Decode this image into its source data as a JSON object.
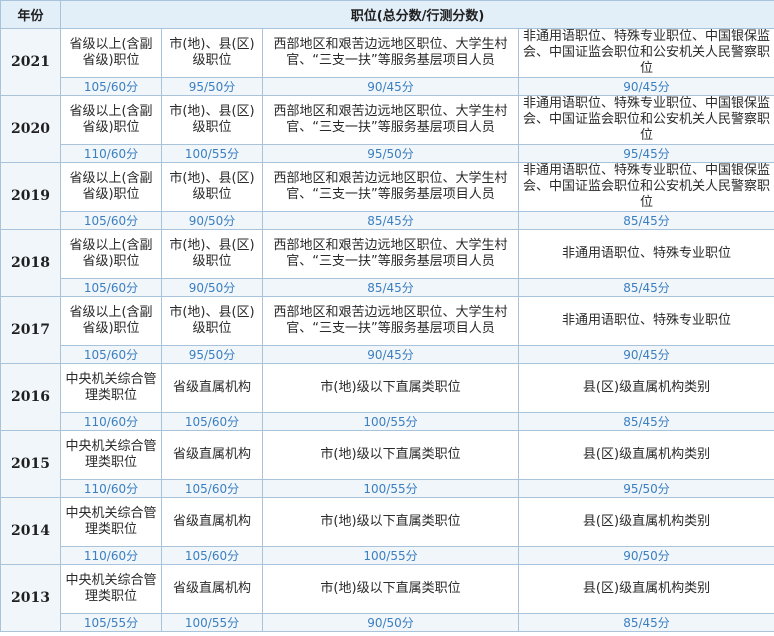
{
  "header": {
    "year_label": "年份",
    "position_label": "职位(总分数/行测分数)"
  },
  "rows": [
    {
      "year": "2021",
      "cells": [
        {
          "position": "省级以上(含副省级)职位",
          "score": "105/60分"
        },
        {
          "position": "市(地)、县(区)级职位",
          "score": "95/50分"
        },
        {
          "position": "西部地区和艰苦边远地区职位、大学生村官、“三支一扶”等服务基层项目人员",
          "score": "90/45分"
        },
        {
          "position": "非通用语职位、特殊专业职位、中国银保监会、中国证监会职位和公安机关人民警察职位",
          "score": "90/45分"
        }
      ]
    },
    {
      "year": "2020",
      "cells": [
        {
          "position": "省级以上(含副省级)职位",
          "score": "110/60分"
        },
        {
          "position": "市(地)、县(区)级职位",
          "score": "100/55分"
        },
        {
          "position": "西部地区和艰苦边远地区职位、大学生村官、“三支一扶”等服务基层项目人员",
          "score": "95/50分"
        },
        {
          "position": "非通用语职位、特殊专业职位、中国银保监会、中国证监会职位和公安机关人民警察职位",
          "score": "95/45分"
        }
      ]
    },
    {
      "year": "2019",
      "cells": [
        {
          "position": "省级以上(含副省级)职位",
          "score": "105/60分"
        },
        {
          "position": "市(地)、县(区)级职位",
          "score": "90/50分"
        },
        {
          "position": "西部地区和艰苦边远地区职位、大学生村官、“三支一扶”等服务基层项目人员",
          "score": "85/45分"
        },
        {
          "position": "非通用语职位、特殊专业职位、中国银保监会、中国证监会职位和公安机关人民警察职位",
          "score": "85/45分"
        }
      ]
    },
    {
      "year": "2018",
      "cells": [
        {
          "position": "省级以上(含副省级)职位",
          "score": "105/60分"
        },
        {
          "position": "市(地)、县(区)级职位",
          "score": "90/50分"
        },
        {
          "position": "西部地区和艰苦边远地区职位、大学生村官、“三支一扶”等服务基层项目人员",
          "score": "85/45分"
        },
        {
          "position": "非通用语职位、特殊专业职位",
          "score": "85/45分"
        }
      ]
    },
    {
      "year": "2017",
      "cells": [
        {
          "position": "省级以上(含副省级)职位",
          "score": "105/60分"
        },
        {
          "position": "市(地)、县(区)级职位",
          "score": "95/50分"
        },
        {
          "position": "西部地区和艰苦边远地区职位、大学生村官、“三支一扶”等服务基层项目人员",
          "score": "90/45分"
        },
        {
          "position": "非通用语职位、特殊专业职位",
          "score": "90/45分"
        }
      ]
    },
    {
      "year": "2016",
      "cells": [
        {
          "position": "中央机关综合管理类职位",
          "score": "110/60分"
        },
        {
          "position": "省级直属机构",
          "score": "105/60分"
        },
        {
          "position": "市(地)级以下直属类职位",
          "score": "100/55分"
        },
        {
          "position": "县(区)级直属机构类别",
          "score": "85/45分"
        }
      ]
    },
    {
      "year": "2015",
      "cells": [
        {
          "position": "中央机关综合管理类职位",
          "score": "110/60分"
        },
        {
          "position": "省级直属机构",
          "score": "105/60分"
        },
        {
          "position": "市(地)级以下直属类职位",
          "score": "100/55分"
        },
        {
          "position": "县(区)级直属机构类别",
          "score": "95/50分"
        }
      ]
    },
    {
      "year": "2014",
      "cells": [
        {
          "position": "中央机关综合管理类职位",
          "score": "110/60分"
        },
        {
          "position": "省级直属机构",
          "score": "105/60分"
        },
        {
          "position": "市(地)级以下直属类职位",
          "score": "100/55分"
        },
        {
          "position": "县(区)级直属机构类别",
          "score": "90/50分"
        }
      ]
    },
    {
      "year": "2013",
      "cells": [
        {
          "position": "中央机关综合管理类职位",
          "score": "105/55分"
        },
        {
          "position": "省级直属机构",
          "score": "100/55分"
        },
        {
          "position": "市(地)级以下直属类职位",
          "score": "90/50分"
        },
        {
          "position": "县(区)级直属机构类别",
          "score": "85/45分"
        }
      ]
    }
  ]
}
